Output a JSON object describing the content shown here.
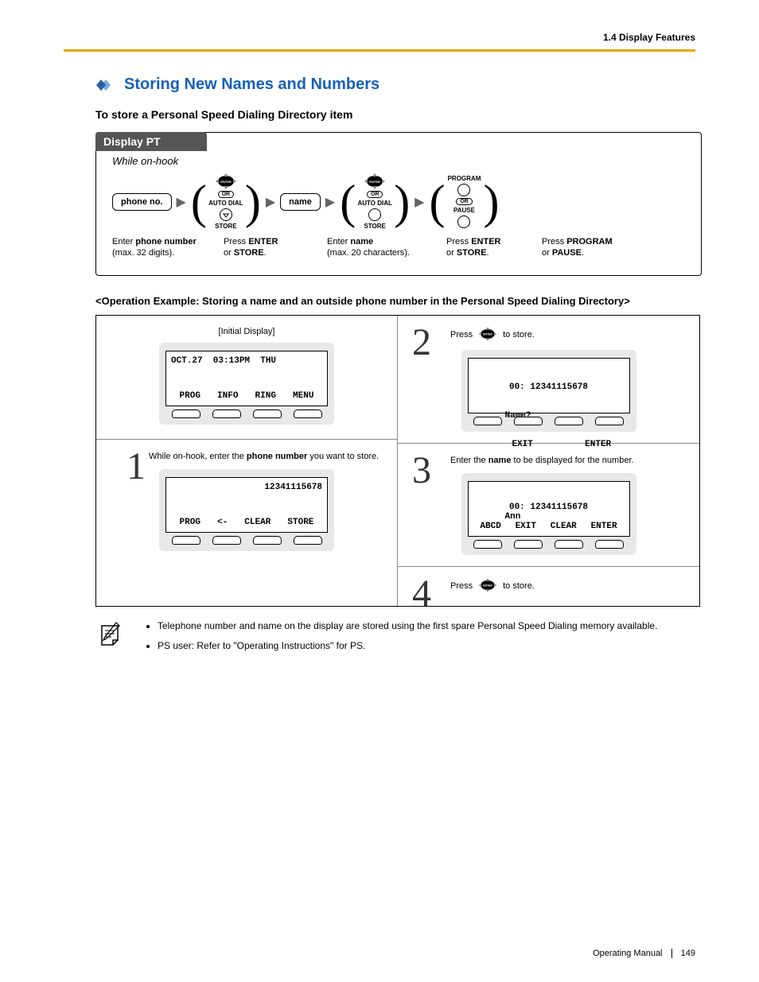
{
  "header": {
    "section_ref": "1.4 Display Features"
  },
  "title": "Storing New Names and Numbers",
  "subtitle": "To store a Personal Speed Dialing Directory item",
  "flow": {
    "header": "Display PT",
    "while_label": "While on-hook",
    "steps": {
      "phone_key": "phone no.",
      "name_key": "name",
      "or": "OR",
      "auto_dial": "AUTO DIAL",
      "store": "STORE",
      "program": "PROGRAM",
      "pause": "PAUSE",
      "enter_small": "ENTER"
    },
    "captions": {
      "c1a": "Enter ",
      "c1b": "phone number",
      "c1c": "(max. 32 digits).",
      "c2a": "Press ",
      "c2b": "ENTER",
      "c2c": "or ",
      "c2d": "STORE",
      "c2e": ".",
      "c3a": "Enter ",
      "c3b": "name",
      "c3c": "(max. 20 characters).",
      "c4a": "Press ",
      "c4b": "ENTER",
      "c4c": "or ",
      "c4d": "STORE",
      "c4e": ".",
      "c5a": "Press ",
      "c5b": "PROGRAM",
      "c5c": "or ",
      "c5d": "PAUSE",
      "c5e": "."
    }
  },
  "example_title": "<Operation Example: Storing a name and an outside phone number in the Personal Speed Dialing Directory>",
  "example": {
    "initial_label": "[Initial Display]",
    "screen0_top": "OCT.27  03:13PM  THU",
    "screen0_soft": [
      "PROG",
      "INFO",
      "RING",
      "MENU"
    ],
    "step1_num": "1",
    "step1_text_a": "While on-hook, enter the ",
    "step1_text_b": "phone number",
    "step1_text_c": " you want to store.",
    "screen1_top": "          12341115678",
    "screen1_soft": [
      "PROG",
      "<-",
      "CLEAR",
      "STORE"
    ],
    "step2_num": "2",
    "step2_text_a": "Press ",
    "step2_text_b": " to store.",
    "screen2_line1": "00: 12341115678",
    "screen2_line2": "Name?",
    "screen2_soft": [
      "",
      "EXIT",
      "",
      "ENTER"
    ],
    "step3_num": "3",
    "step3_text_a": "Enter the ",
    "step3_text_b": "name",
    "step3_text_c": " to be displayed for the number.",
    "screen3_line1": "00: 12341115678",
    "screen3_line2": "Ann",
    "screen3_soft": [
      "ABCD",
      "EXIT",
      "CLEAR",
      "ENTER"
    ],
    "step4_num": "4",
    "step4_text_a": "Press ",
    "step4_text_b": " to store."
  },
  "notes": {
    "item1": "Telephone number and name on the display are stored using the first spare Personal Speed Dialing memory available.",
    "item2": "PS user: Refer to \"Operating Instructions\" for PS."
  },
  "footer": {
    "label": "Operating Manual",
    "page": "149"
  }
}
